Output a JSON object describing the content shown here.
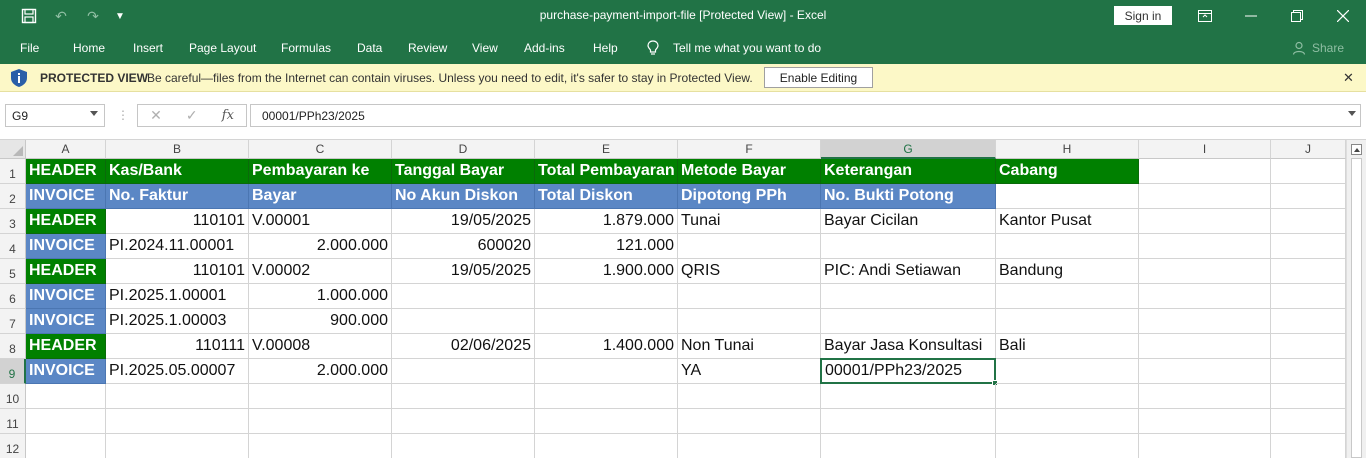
{
  "window": {
    "title": "purchase-payment-import-file  [Protected View]  -  Excel",
    "sign_in": "Sign in"
  },
  "ribbon": {
    "tabs": [
      "File",
      "Home",
      "Insert",
      "Page Layout",
      "Formulas",
      "Data",
      "Review",
      "View",
      "Add-ins",
      "Help"
    ],
    "tell_me": "Tell me what you want to do",
    "share": "Share"
  },
  "protected_view": {
    "title": "PROTECTED VIEW",
    "message": "Be careful—files from the Internet can contain viruses. Unless you need to edit, it's safer to stay in Protected View.",
    "enable_button": "Enable Editing"
  },
  "formula_bar": {
    "name_box": "G9",
    "fx": "fx",
    "value": "00001/PPh23/2025"
  },
  "sheet": {
    "columns": [
      "A",
      "B",
      "C",
      "D",
      "E",
      "F",
      "G",
      "H",
      "I",
      "J"
    ],
    "row_numbers": [
      "1",
      "2",
      "3",
      "4",
      "5",
      "6",
      "7",
      "8",
      "9",
      "10",
      "11",
      "12"
    ],
    "selected_cell": {
      "col": "G",
      "row": "9"
    },
    "colors": {
      "header_green": "#008000",
      "invoice_blue": "#5b87c5",
      "accent": "#217346"
    },
    "rows": [
      [
        "HEADER",
        "Kas/Bank",
        "Pembayaran ke",
        "Tanggal Bayar",
        "Total Pembayaran",
        "Metode Bayar",
        "Keterangan",
        "Cabang"
      ],
      [
        "INVOICE",
        "No. Faktur",
        "Bayar",
        "No Akun Diskon",
        "Total Diskon",
        "Dipotong PPh",
        "No. Bukti Potong",
        ""
      ],
      [
        "HEADER",
        "110101",
        "V.00001",
        "19/05/2025",
        "1.879.000",
        "Tunai",
        "Bayar Cicilan",
        "Kantor Pusat"
      ],
      [
        "INVOICE",
        "PI.2024.11.00001",
        "2.000.000",
        "600020",
        "121.000",
        "",
        "",
        ""
      ],
      [
        "HEADER",
        "110101",
        "V.00002",
        "19/05/2025",
        "1.900.000",
        "QRIS",
        "PIC: Andi Setiawan",
        "Bandung"
      ],
      [
        "INVOICE",
        "PI.2025.1.00001",
        "1.000.000",
        "",
        "",
        "",
        "",
        ""
      ],
      [
        "INVOICE",
        "PI.2025.1.00003",
        "900.000",
        "",
        "",
        "",
        "",
        ""
      ],
      [
        "HEADER",
        "110111",
        "V.00008",
        "02/06/2025",
        "1.400.000",
        "Non Tunai",
        "Bayar Jasa Konsultasi",
        "Bali"
      ],
      [
        "INVOICE",
        "PI.2025.05.00007",
        "2.000.000",
        "",
        "",
        "YA",
        "00001/PPh23/2025",
        ""
      ]
    ]
  }
}
